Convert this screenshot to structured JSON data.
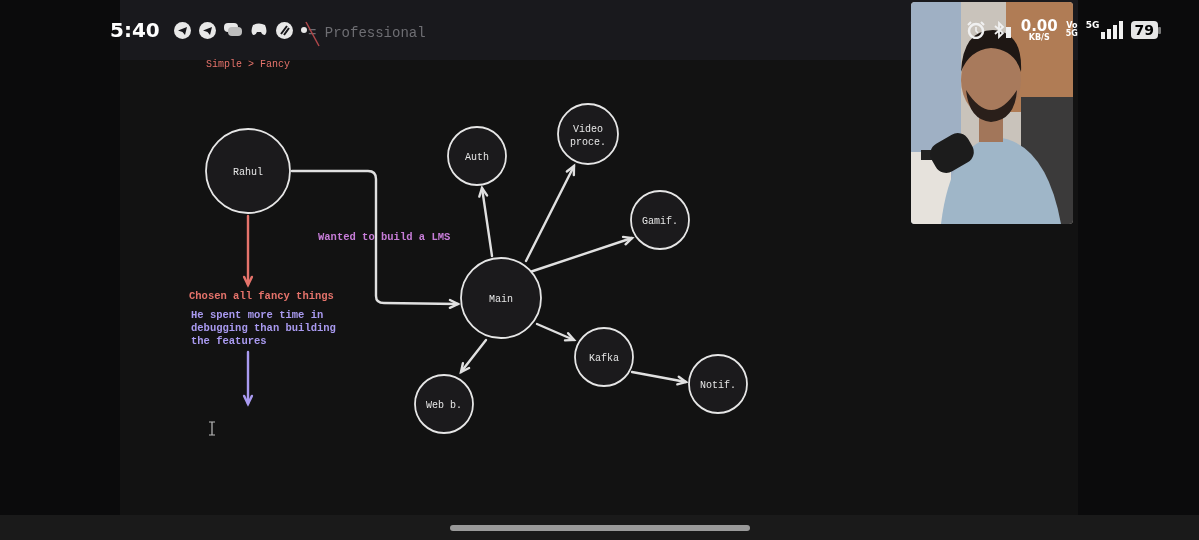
{
  "status_bar": {
    "time": "5:40",
    "speed": "0.00",
    "speed_unit": "KB/S",
    "volte_top": "Vo",
    "volte_bottom": "5G",
    "network": "5G",
    "battery": "79"
  },
  "whiteboard": {
    "heading": "= Professional",
    "subheading": "Simple > Fancy",
    "nodes": [
      {
        "lines": [
          "Rahul"
        ]
      },
      {
        "lines": [
          "Auth"
        ]
      },
      {
        "lines": [
          "Video",
          "proce."
        ]
      },
      {
        "lines": [
          "Gamif."
        ]
      },
      {
        "lines": [
          "Main"
        ]
      },
      {
        "lines": [
          "Kafka"
        ]
      },
      {
        "lines": [
          "Notif."
        ]
      },
      {
        "lines": [
          "Web b."
        ]
      }
    ],
    "notes": [
      {
        "lines": [
          "Wanted to build a LMS"
        ],
        "color": "#c77dd8"
      },
      {
        "lines": [
          "Chosen all fancy things"
        ],
        "color": "#e5736b"
      },
      {
        "lines": [
          "He spent more time in",
          "debugging than building",
          "the features"
        ],
        "color": "#a99af0"
      }
    ],
    "arrows": [
      {
        "color": "#e0e0e0"
      },
      {
        "color": "#e5736b"
      },
      {
        "color": "#a99af0"
      },
      {
        "color": "#e0e0e0"
      },
      {
        "color": "#e0e0e0"
      },
      {
        "color": "#e0e0e0"
      },
      {
        "color": "#e0e0e0"
      },
      {
        "color": "#e0e0e0"
      },
      {
        "color": "#e0e0e0"
      }
    ]
  }
}
